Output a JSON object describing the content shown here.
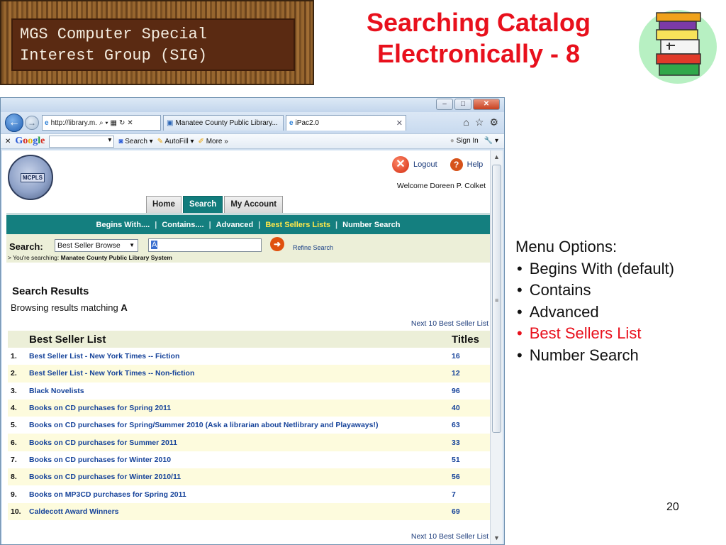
{
  "slide": {
    "sig_banner_lines": [
      "MGS Computer Special",
      "Interest Group (SIG)"
    ],
    "title_lines": [
      "Searching Catalog",
      "Electronically - 8"
    ],
    "page_number": "20",
    "menu_options_heading": "Menu Options:",
    "menu_options": [
      "Begins With (default)",
      "Contains",
      "Advanced",
      "Best Sellers List",
      "Number Search"
    ],
    "highlight_option_index": 3,
    "colors": {
      "title": "#e8101c",
      "teal": "#147f7f",
      "link": "#16439a"
    }
  },
  "browser": {
    "address": "http://library.m.",
    "tabs": [
      "Manatee County Public Library...",
      "iPac2.0"
    ],
    "toolbar": {
      "google_label": "Google",
      "search_label": "Search",
      "autofill_label": "AutoFill",
      "more_label": "More",
      "signin_label": "Sign In"
    }
  },
  "page": {
    "logo_text": "MCPLS",
    "logout_label": "Logout",
    "help_label": "Help",
    "welcome": "Welcome Doreen P. Colket",
    "tabs": [
      "Home",
      "Search",
      "My Account"
    ],
    "menu": [
      "Begins With....",
      "Contains....",
      "Advanced",
      "Best Sellers Lists",
      "Number Search"
    ],
    "search_label": "Search:",
    "search_type": "Best Seller Browse",
    "search_query": "A",
    "refine_label": "Refine Search",
    "searching_prefix": "> You're searching:",
    "searching_library": "Manatee County Public Library System",
    "results_title": "Search Results",
    "browsing_prefix": "Browsing results matching",
    "browsing_term": "A",
    "next_link": "Next 10 Best Seller List",
    "table_headers": [
      "Best Seller List",
      "Titles"
    ],
    "rows": [
      {
        "num": "1.",
        "name": "Best Seller List - New York Times -- Fiction",
        "titles": "16"
      },
      {
        "num": "2.",
        "name": "Best Seller List - New York Times -- Non-fiction",
        "titles": "12"
      },
      {
        "num": "3.",
        "name": "Black Novelists",
        "titles": "96"
      },
      {
        "num": "4.",
        "name": "Books on CD purchases for Spring 2011",
        "titles": "40"
      },
      {
        "num": "5.",
        "name": "Books on CD purchases for Spring/Summer 2010 (Ask a librarian about Netlibrary and Playaways!)",
        "titles": "63"
      },
      {
        "num": "6.",
        "name": "Books on CD purchases for Summer 2011",
        "titles": "33"
      },
      {
        "num": "7.",
        "name": "Books on CD purchases for Winter 2010",
        "titles": "51"
      },
      {
        "num": "8.",
        "name": "Books on CD purchases for Winter 2010/11",
        "titles": "56"
      },
      {
        "num": "9.",
        "name": "Books on MP3CD purchases for Spring 2011",
        "titles": "7"
      },
      {
        "num": "10.",
        "name": "Caldecott Award Winners",
        "titles": "69"
      }
    ]
  }
}
